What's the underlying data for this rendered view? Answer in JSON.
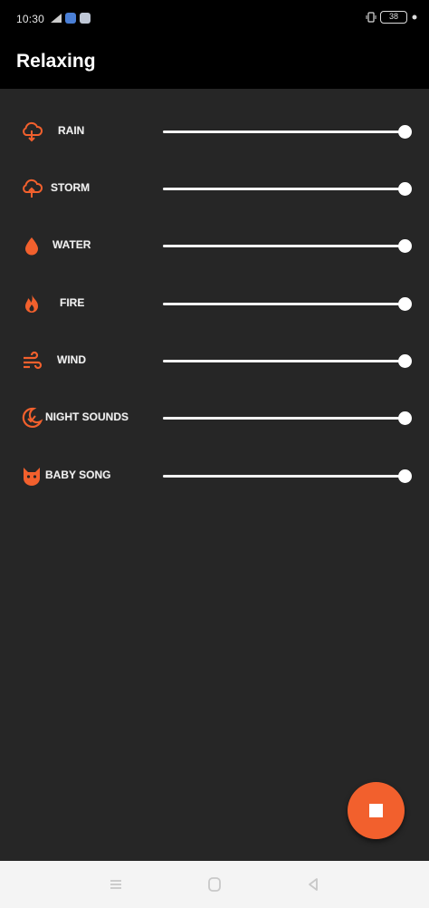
{
  "status": {
    "time": "10:30",
    "battery": "38"
  },
  "app": {
    "title": "Relaxing",
    "accent": "#f2602d"
  },
  "sounds": [
    {
      "label": "RAIN",
      "icon": "cloud-rain-icon",
      "volume": 1.0
    },
    {
      "label": "STORM",
      "icon": "cloud-storm-icon",
      "volume": 1.0
    },
    {
      "label": "WATER",
      "icon": "water-drop-icon",
      "volume": 1.0
    },
    {
      "label": "FIRE",
      "icon": "fire-icon",
      "volume": 1.0
    },
    {
      "label": "WIND",
      "icon": "wind-icon",
      "volume": 1.0
    },
    {
      "label": "NIGHT SOUNDS",
      "icon": "moon-icon",
      "volume": 1.0
    },
    {
      "label": "BABY SONG",
      "icon": "baby-cat-icon",
      "volume": 1.0
    }
  ],
  "fab": {
    "icon": "stop-icon"
  },
  "navbar": {
    "icons": [
      "menu-icon",
      "home-icon",
      "back-icon"
    ]
  }
}
